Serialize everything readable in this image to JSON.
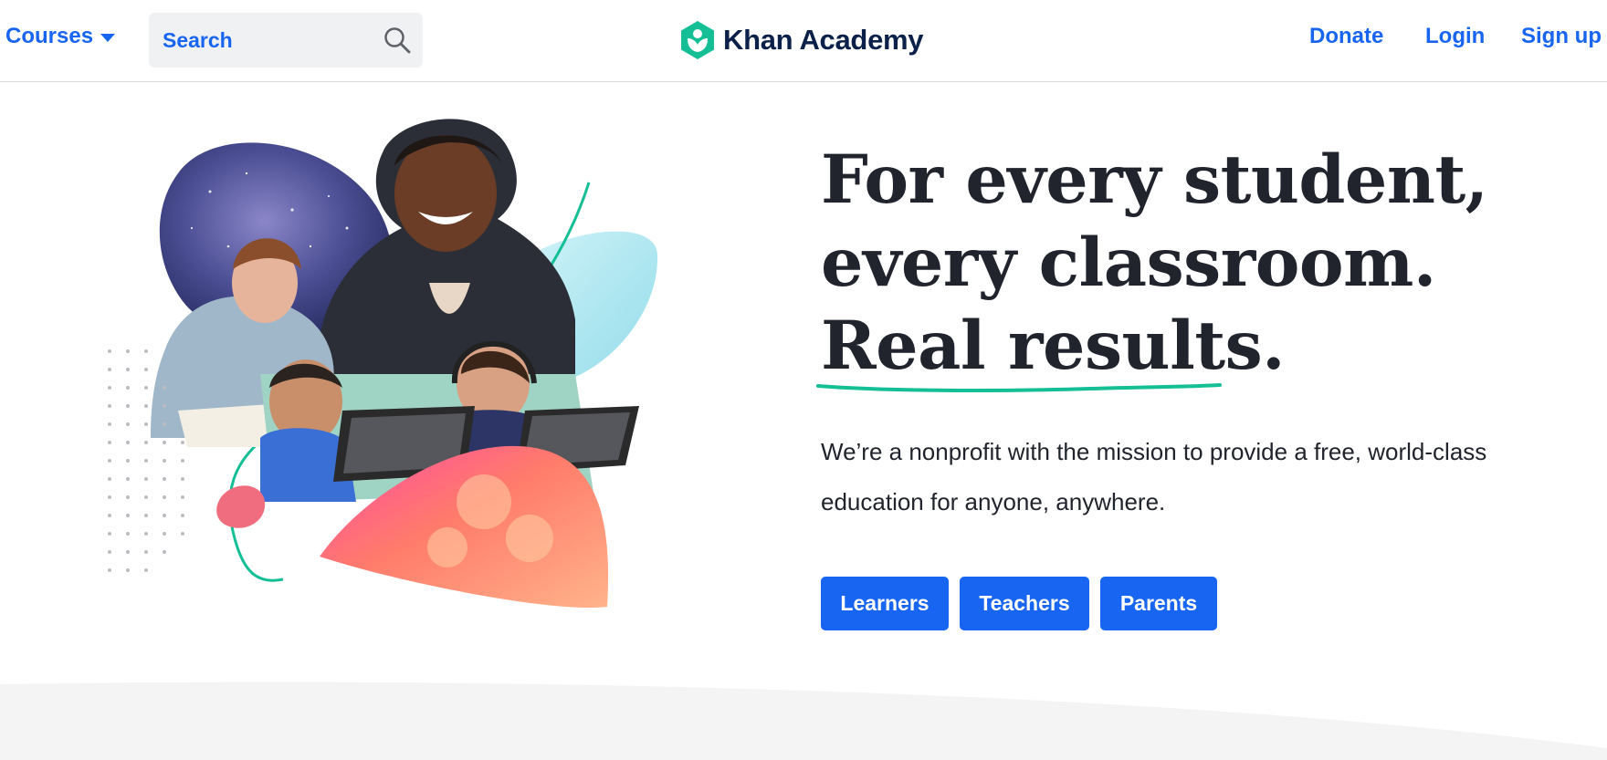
{
  "header": {
    "courses_label": "Courses",
    "search_placeholder": "Search",
    "logo_text": "Khan Academy",
    "donate_label": "Donate",
    "login_label": "Login",
    "signup_label": "Sign up"
  },
  "hero": {
    "headline_line1": "For every student,",
    "headline_line2": "every classroom.",
    "headline_line3": "Real results.",
    "description": "We’re a nonprofit with the mission to provide a free, world-class education for anyone, anywhere.",
    "buttons": {
      "learners": "Learners",
      "teachers": "Teachers",
      "parents": "Parents"
    }
  },
  "colors": {
    "accent": "#1865f2",
    "brand_green": "#14bf96",
    "text_dark": "#21242c",
    "logo_text": "#0b2149"
  },
  "icons": {
    "search": "search-icon",
    "courses_dropdown": "caret-down-icon",
    "logo": "khan-academy-logo-icon"
  }
}
